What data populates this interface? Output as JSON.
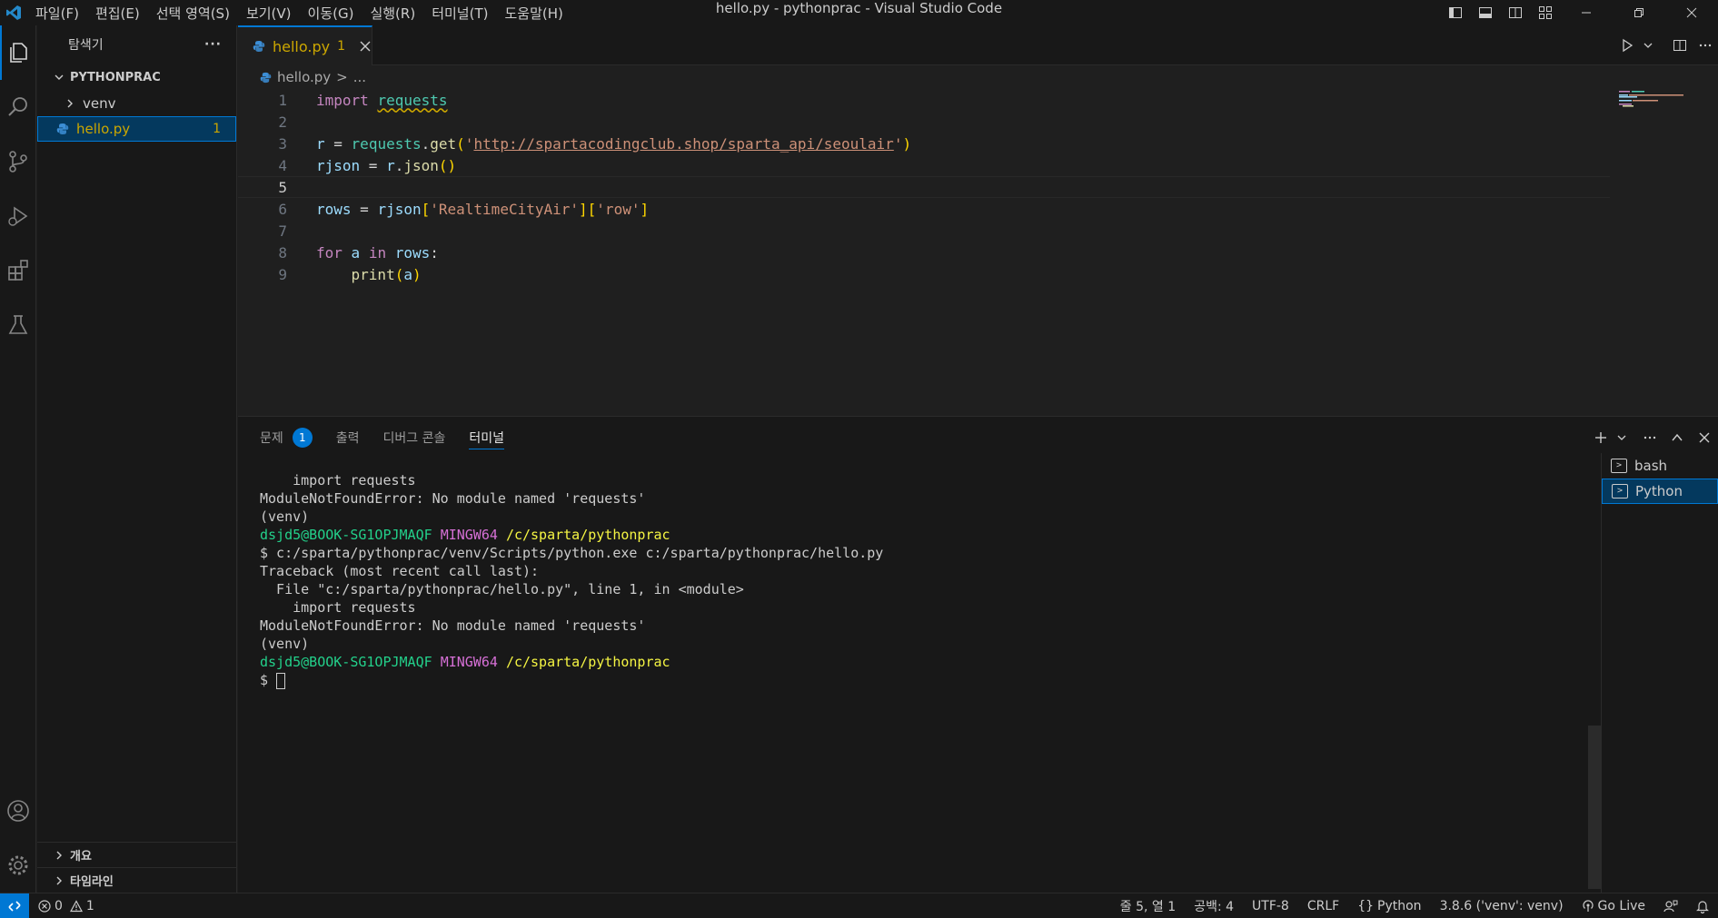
{
  "window": {
    "title": "hello.py - pythonprac - Visual Studio Code",
    "menu": [
      "파일(F)",
      "편집(E)",
      "선택 영역(S)",
      "보기(V)",
      "이동(G)",
      "실행(R)",
      "터미널(T)",
      "도움말(H)"
    ]
  },
  "sidebar": {
    "title": "탐색기",
    "more": "···",
    "workspace": "PYTHONPRAC",
    "tree": [
      {
        "label": "venv",
        "type": "folder"
      },
      {
        "label": "hello.py",
        "type": "file",
        "problems": "1"
      }
    ],
    "outline": "개요",
    "timeline": "타임라인"
  },
  "editor": {
    "tab": {
      "name": "hello.py",
      "problems": "1"
    },
    "breadcrumb": {
      "file": "hello.py",
      "sep": ">",
      "rest": "..."
    },
    "line_numbers": [
      "1",
      "2",
      "3",
      "4",
      "5",
      "6",
      "7",
      "8",
      "9"
    ],
    "code": {
      "l1_kw": "import",
      "l1_mod": "requests",
      "l3_var": "r",
      "l3_eq": " = ",
      "l3_mod": "requests",
      "l3_dot": ".",
      "l3_fn": "get",
      "l3_open": "(",
      "l3_q1": "'",
      "l3_url": "http://spartacodingclub.shop/sparta_api/seoulair",
      "l3_q2": "'",
      "l3_close": ")",
      "l4_var": "rjson",
      "l4_eq": " = ",
      "l4_obj": "r",
      "l4_dot": ".",
      "l4_fn": "json",
      "l4_parens": "()",
      "l6_var": "rows",
      "l6_eq": " = ",
      "l6_obj": "rjson",
      "l6_b1o": "[",
      "l6_key1": "'RealtimeCityAir'",
      "l6_b1c": "]",
      "l6_b2o": "[",
      "l6_key2": "'row'",
      "l6_b2c": "]",
      "l8_for": "for",
      "l8_var": "a",
      "l8_in": "in",
      "l8_iter": "rows",
      "l8_colon": ":",
      "l9_indent": "    ",
      "l9_fn": "print",
      "l9_open": "(",
      "l9_arg": "a",
      "l9_close": ")"
    },
    "current_line": 5
  },
  "panel": {
    "tabs": [
      {
        "label": "문제",
        "badge": "1"
      },
      {
        "label": "출력"
      },
      {
        "label": "디버그 콘솔"
      },
      {
        "label": "터미널",
        "active": true
      }
    ],
    "terminal": {
      "lines": [
        "    import requests",
        "ModuleNotFoundError: No module named 'requests'",
        "(venv)"
      ],
      "prompt1": {
        "user": "dsjd5@BOOK-SG1OPJMAQF",
        "sys": "MINGW64",
        "path": "/c/sparta/pythonprac"
      },
      "cmd": "$ c:/sparta/pythonprac/venv/Scripts/python.exe c:/sparta/pythonprac/hello.py",
      "lines2": [
        "Traceback (most recent call last):",
        "  File \"c:/sparta/pythonprac/hello.py\", line 1, in <module>",
        "    import requests",
        "ModuleNotFoundError: No module named 'requests'",
        "(venv)"
      ],
      "prompt2": {
        "user": "dsjd5@BOOK-SG1OPJMAQF",
        "sys": "MINGW64",
        "path": "/c/sparta/pythonprac"
      },
      "input_prompt": "$ "
    },
    "terminals": [
      "bash",
      "Python"
    ]
  },
  "statusbar": {
    "errors": "0",
    "warnings": "1",
    "position": "줄 5, 열 1",
    "spaces": "공백: 4",
    "encoding": "UTF-8",
    "eol": "CRLF",
    "language": "Python",
    "interpreter": "3.8.6 ('venv': venv)",
    "golive": "Go Live"
  },
  "colors": {
    "accent": "#0078d4",
    "warning": "#cca700",
    "terminal_green": "#23d18b",
    "terminal_magenta": "#d670d6",
    "terminal_yellow": "#f5f543"
  }
}
